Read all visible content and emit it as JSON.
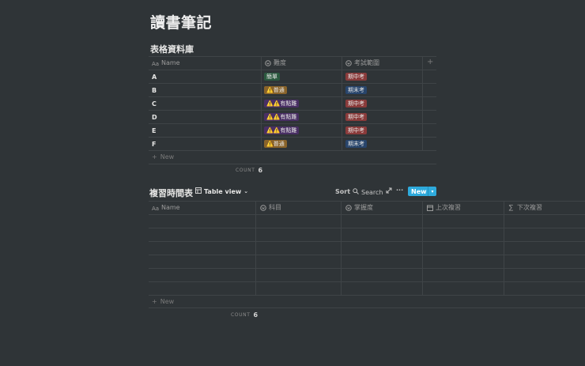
{
  "page": {
    "title": "讀書筆記"
  },
  "db1": {
    "title": "表格資料庫",
    "columns": [
      "Name",
      "難度",
      "考試範圍"
    ],
    "rows": [
      {
        "name": "A",
        "difficulty": "簡單",
        "diff_color": "#2b593f",
        "scope": "期中考",
        "scope_color": "#8a3b3b"
      },
      {
        "name": "B",
        "difficulty": "⚠️普通",
        "diff_color": "#89632a",
        "scope": "期末考",
        "scope_color": "#28456c"
      },
      {
        "name": "C",
        "difficulty": "⚠️⚠️有點難",
        "diff_color": "#492f64",
        "scope": "期中考",
        "scope_color": "#8a3b3b"
      },
      {
        "name": "D",
        "difficulty": "⚠️⚠️有點難",
        "diff_color": "#492f64",
        "scope": "期中考",
        "scope_color": "#8a3b3b"
      },
      {
        "name": "E",
        "difficulty": "⚠️⚠️有點難",
        "diff_color": "#492f64",
        "scope": "期中考",
        "scope_color": "#8a3b3b"
      },
      {
        "name": "F",
        "difficulty": "⚠️普通",
        "diff_color": "#89632a",
        "scope": "期末考",
        "scope_color": "#28456c"
      }
    ],
    "new_label": "New",
    "count_label": "COUNT",
    "count_value": "6",
    "add_column": "+"
  },
  "db2": {
    "title": "複習時間表",
    "view_label": "Table view",
    "sort_label": "Sort",
    "search_label": "Search",
    "new_button": "New",
    "columns": [
      "Name",
      "科目",
      "掌握度",
      "上次複習",
      "下次複習"
    ],
    "new_label": "New",
    "count_label": "COUNT",
    "count_value": "6"
  },
  "colors": {
    "background": "#2f3437",
    "accent": "#2eaadc",
    "grid": "#3f4447"
  }
}
